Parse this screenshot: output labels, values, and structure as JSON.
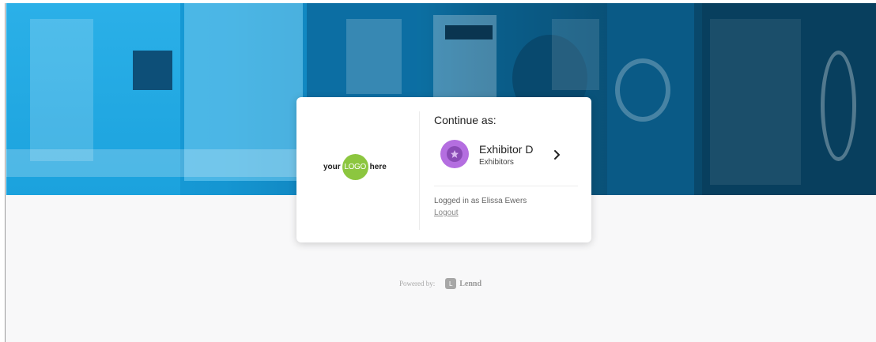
{
  "logo": {
    "left_text": "your",
    "circle_text": "LOGO",
    "right_text": "here"
  },
  "card": {
    "title": "Continue as:",
    "account": {
      "name": "Exhibitor D",
      "role": "Exhibitors",
      "avatar_color": "#b46ee0",
      "avatar_icon": "star-icon"
    },
    "logged_in_text": "Logged in as Elissa Ewers",
    "logout_label": "Logout"
  },
  "footer": {
    "powered_by_label": "Powered by:",
    "brand_icon_letter": "L",
    "brand_name": "Lennd"
  },
  "colors": {
    "hero_blue": "#1596d2",
    "logo_green": "#8cc63f"
  }
}
